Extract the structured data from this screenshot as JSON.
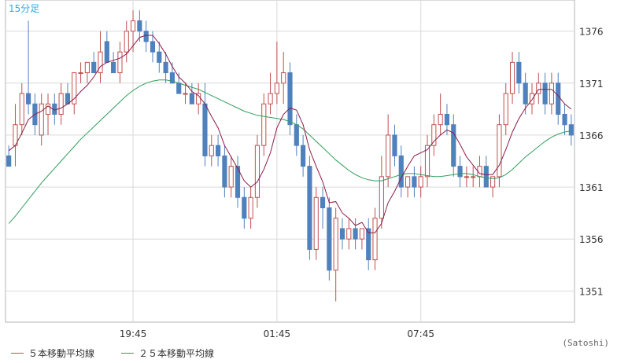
{
  "chart_data": {
    "type": "candlestick",
    "timeframe_label": "15分足",
    "y_ticks": [
      1351,
      1356,
      1361,
      1366,
      1371,
      1376
    ],
    "ylim": [
      1348,
      1379
    ],
    "x_ticks": [
      "19:45",
      "01:45",
      "07:45"
    ],
    "colors": {
      "up": "#c0504d",
      "down": "#4f81bd",
      "ma5": "#8b1a4a",
      "ma25": "#2e9e5b",
      "grid": "#d9d9d9",
      "label": "#29abe2"
    },
    "candles": [
      {
        "o": 1364,
        "h": 1365,
        "l": 1363,
        "c": 1363
      },
      {
        "o": 1365,
        "h": 1369,
        "l": 1363,
        "c": 1367
      },
      {
        "o": 1367,
        "h": 1371,
        "l": 1366,
        "c": 1370
      },
      {
        "o": 1370,
        "h": 1377,
        "l": 1368,
        "c": 1369
      },
      {
        "o": 1369,
        "h": 1370,
        "l": 1366,
        "c": 1367
      },
      {
        "o": 1366,
        "h": 1370,
        "l": 1365,
        "c": 1369
      },
      {
        "o": 1368,
        "h": 1370,
        "l": 1366,
        "c": 1369
      },
      {
        "o": 1369,
        "h": 1370,
        "l": 1367,
        "c": 1368
      },
      {
        "o": 1368,
        "h": 1371,
        "l": 1367,
        "c": 1370
      },
      {
        "o": 1370,
        "h": 1371,
        "l": 1369,
        "c": 1369
      },
      {
        "o": 1369,
        "h": 1372,
        "l": 1368,
        "c": 1372
      },
      {
        "o": 1372,
        "h": 1373,
        "l": 1371,
        "c": 1372
      },
      {
        "o": 1372,
        "h": 1373,
        "l": 1371,
        "c": 1373
      },
      {
        "o": 1373,
        "h": 1374,
        "l": 1372,
        "c": 1372
      },
      {
        "o": 1372,
        "h": 1376,
        "l": 1371,
        "c": 1374
      },
      {
        "o": 1375,
        "h": 1376,
        "l": 1373,
        "c": 1373
      },
      {
        "o": 1373,
        "h": 1374,
        "l": 1372,
        "c": 1372
      },
      {
        "o": 1372,
        "h": 1375,
        "l": 1371,
        "c": 1374
      },
      {
        "o": 1374,
        "h": 1377,
        "l": 1373,
        "c": 1376
      },
      {
        "o": 1376,
        "h": 1378,
        "l": 1374,
        "c": 1377
      },
      {
        "o": 1377,
        "h": 1378,
        "l": 1375,
        "c": 1376
      },
      {
        "o": 1376,
        "h": 1377,
        "l": 1374,
        "c": 1375
      },
      {
        "o": 1375,
        "h": 1376,
        "l": 1373,
        "c": 1374
      },
      {
        "o": 1374,
        "h": 1375,
        "l": 1372,
        "c": 1373
      },
      {
        "o": 1373,
        "h": 1374,
        "l": 1371,
        "c": 1372
      },
      {
        "o": 1372,
        "h": 1373,
        "l": 1371,
        "c": 1371
      },
      {
        "o": 1371,
        "h": 1372,
        "l": 1370,
        "c": 1370
      },
      {
        "o": 1370,
        "h": 1371,
        "l": 1369,
        "c": 1370
      },
      {
        "o": 1370,
        "h": 1371,
        "l": 1369,
        "c": 1369
      },
      {
        "o": 1369,
        "h": 1371,
        "l": 1368,
        "c": 1370
      },
      {
        "o": 1369,
        "h": 1371,
        "l": 1363,
        "c": 1364
      },
      {
        "o": 1364,
        "h": 1366,
        "l": 1363,
        "c": 1365
      },
      {
        "o": 1365,
        "h": 1366,
        "l": 1363,
        "c": 1364
      },
      {
        "o": 1364,
        "h": 1365,
        "l": 1360,
        "c": 1361
      },
      {
        "o": 1361,
        "h": 1364,
        "l": 1360,
        "c": 1363
      },
      {
        "o": 1363,
        "h": 1364,
        "l": 1359,
        "c": 1360
      },
      {
        "o": 1360,
        "h": 1361,
        "l": 1357,
        "c": 1358
      },
      {
        "o": 1358,
        "h": 1361,
        "l": 1357,
        "c": 1360
      },
      {
        "o": 1360,
        "h": 1366,
        "l": 1359,
        "c": 1365
      },
      {
        "o": 1365,
        "h": 1370,
        "l": 1364,
        "c": 1369
      },
      {
        "o": 1369,
        "h": 1372,
        "l": 1368,
        "c": 1370
      },
      {
        "o": 1370,
        "h": 1375,
        "l": 1369,
        "c": 1371
      },
      {
        "o": 1371,
        "h": 1374,
        "l": 1369,
        "c": 1372
      },
      {
        "o": 1372,
        "h": 1373,
        "l": 1366,
        "c": 1367
      },
      {
        "o": 1367,
        "h": 1368,
        "l": 1364,
        "c": 1365
      },
      {
        "o": 1365,
        "h": 1366,
        "l": 1362,
        "c": 1363
      },
      {
        "o": 1363,
        "h": 1364,
        "l": 1354,
        "c": 1355
      },
      {
        "o": 1355,
        "h": 1361,
        "l": 1354,
        "c": 1360
      },
      {
        "o": 1360,
        "h": 1361,
        "l": 1357,
        "c": 1359
      },
      {
        "o": 1359,
        "h": 1360,
        "l": 1352,
        "c": 1353
      },
      {
        "o": 1353,
        "h": 1359,
        "l": 1350,
        "c": 1358
      },
      {
        "o": 1357,
        "h": 1358,
        "l": 1355,
        "c": 1356
      },
      {
        "o": 1356,
        "h": 1358,
        "l": 1355,
        "c": 1357
      },
      {
        "o": 1357,
        "h": 1358,
        "l": 1355,
        "c": 1356
      },
      {
        "o": 1356,
        "h": 1357,
        "l": 1355,
        "c": 1357
      },
      {
        "o": 1357,
        "h": 1358,
        "l": 1353,
        "c": 1354
      },
      {
        "o": 1354,
        "h": 1359,
        "l": 1353,
        "c": 1358
      },
      {
        "o": 1358,
        "h": 1364,
        "l": 1357,
        "c": 1362
      },
      {
        "o": 1362,
        "h": 1368,
        "l": 1361,
        "c": 1366
      },
      {
        "o": 1366,
        "h": 1367,
        "l": 1363,
        "c": 1364
      },
      {
        "o": 1364,
        "h": 1365,
        "l": 1360,
        "c": 1361
      },
      {
        "o": 1361,
        "h": 1362,
        "l": 1360,
        "c": 1362
      },
      {
        "o": 1362,
        "h": 1363,
        "l": 1360,
        "c": 1361
      },
      {
        "o": 1361,
        "h": 1363,
        "l": 1360,
        "c": 1362
      },
      {
        "o": 1362,
        "h": 1366,
        "l": 1361,
        "c": 1365
      },
      {
        "o": 1365,
        "h": 1368,
        "l": 1364,
        "c": 1367
      },
      {
        "o": 1367,
        "h": 1370,
        "l": 1366,
        "c": 1368
      },
      {
        "o": 1368,
        "h": 1369,
        "l": 1366,
        "c": 1367
      },
      {
        "o": 1367,
        "h": 1368,
        "l": 1362,
        "c": 1363
      },
      {
        "o": 1363,
        "h": 1364,
        "l": 1361,
        "c": 1362
      },
      {
        "o": 1362,
        "h": 1363,
        "l": 1361,
        "c": 1362
      },
      {
        "o": 1362,
        "h": 1363,
        "l": 1361,
        "c": 1362
      },
      {
        "o": 1362,
        "h": 1364,
        "l": 1361,
        "c": 1363
      },
      {
        "o": 1363,
        "h": 1364,
        "l": 1361,
        "c": 1361
      },
      {
        "o": 1361,
        "h": 1362,
        "l": 1360,
        "c": 1362
      },
      {
        "o": 1362,
        "h": 1368,
        "l": 1361,
        "c": 1367
      },
      {
        "o": 1367,
        "h": 1371,
        "l": 1366,
        "c": 1370
      },
      {
        "o": 1370,
        "h": 1374,
        "l": 1369,
        "c": 1373
      },
      {
        "o": 1373,
        "h": 1374,
        "l": 1370,
        "c": 1371
      },
      {
        "o": 1371,
        "h": 1372,
        "l": 1368,
        "c": 1369
      },
      {
        "o": 1369,
        "h": 1371,
        "l": 1368,
        "c": 1370
      },
      {
        "o": 1370,
        "h": 1372,
        "l": 1369,
        "c": 1371
      },
      {
        "o": 1371,
        "h": 1372,
        "l": 1368,
        "c": 1369
      },
      {
        "o": 1369,
        "h": 1372,
        "l": 1368,
        "c": 1371
      },
      {
        "o": 1371,
        "h": 1372,
        "l": 1367,
        "c": 1368
      },
      {
        "o": 1368,
        "h": 1369,
        "l": 1366,
        "c": 1367
      },
      {
        "o": 1367,
        "h": 1368,
        "l": 1365,
        "c": 1366
      }
    ],
    "ma5": [
      1364.5,
      1365.0,
      1366.2,
      1367.5,
      1368.0,
      1368.3,
      1368.8,
      1368.4,
      1368.6,
      1369.0,
      1369.5,
      1370.2,
      1370.8,
      1371.6,
      1372.6,
      1373.0,
      1373.2,
      1373.4,
      1373.8,
      1374.6,
      1375.4,
      1375.6,
      1375.6,
      1374.8,
      1373.8,
      1372.6,
      1371.6,
      1371.0,
      1370.2,
      1369.8,
      1369.0,
      1367.8,
      1366.7,
      1365.0,
      1363.9,
      1362.8,
      1361.6,
      1361.0,
      1361.5,
      1362.7,
      1364.3,
      1366.7,
      1368.0,
      1368.6,
      1368.4,
      1367.0,
      1364.6,
      1363.0,
      1361.5,
      1359.5,
      1359.6,
      1358.5,
      1358.0,
      1357.3,
      1357.6,
      1356.6,
      1356.6,
      1357.5,
      1359.5,
      1360.6,
      1361.9,
      1363.0,
      1364.0,
      1364.3,
      1364.6,
      1365.4,
      1366.0,
      1366.5,
      1366.2,
      1365.1,
      1363.9,
      1363.1,
      1362.3,
      1362.2,
      1362.2,
      1363.1,
      1364.6,
      1366.3,
      1367.6,
      1368.6,
      1369.4,
      1370.4,
      1370.4,
      1370.4,
      1369.8,
      1369.0,
      1368.5
    ],
    "ma25": [
      1357.5,
      1358.2,
      1359.0,
      1359.8,
      1360.6,
      1361.4,
      1362.1,
      1362.8,
      1363.5,
      1364.2,
      1364.9,
      1365.6,
      1366.2,
      1366.8,
      1367.4,
      1368.0,
      1368.6,
      1369.2,
      1369.8,
      1370.3,
      1370.7,
      1371.0,
      1371.2,
      1371.3,
      1371.3,
      1371.2,
      1371.0,
      1370.8,
      1370.6,
      1370.4,
      1370.1,
      1369.8,
      1369.5,
      1369.2,
      1368.9,
      1368.6,
      1368.3,
      1368.1,
      1367.9,
      1367.8,
      1367.7,
      1367.6,
      1367.5,
      1367.3,
      1367.0,
      1366.6,
      1366.0,
      1365.4,
      1364.8,
      1364.2,
      1363.6,
      1363.1,
      1362.6,
      1362.2,
      1361.9,
      1361.7,
      1361.6,
      1361.6,
      1361.8,
      1362.0,
      1362.2,
      1362.3,
      1362.3,
      1362.2,
      1362.1,
      1362.0,
      1362.0,
      1362.1,
      1362.2,
      1362.3,
      1362.3,
      1362.2,
      1362.0,
      1361.9,
      1361.8,
      1361.9,
      1362.2,
      1362.7,
      1363.3,
      1363.9,
      1364.4,
      1364.9,
      1365.4,
      1365.8,
      1366.1,
      1366.3,
      1366.4
    ]
  },
  "legend": {
    "ma5_label": "５本移動平均線",
    "ma25_label": "２５本移動平均線"
  },
  "credit": "(Satoshi)"
}
